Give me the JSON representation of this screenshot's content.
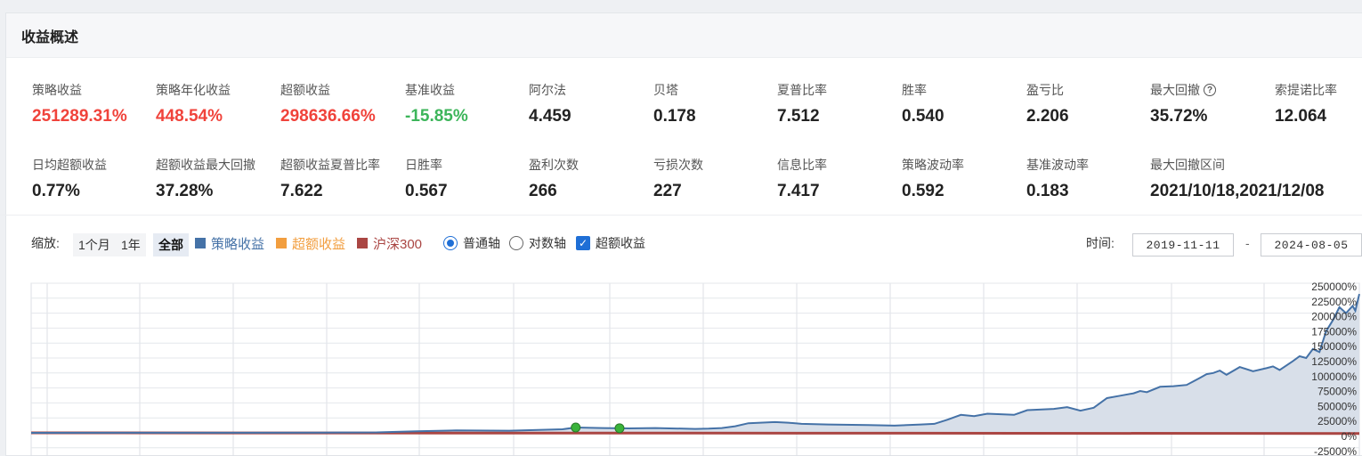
{
  "panel": {
    "title": "收益概述"
  },
  "stats_row1": [
    {
      "label": "策略收益",
      "value": "251289.31%",
      "color": "#f0433b"
    },
    {
      "label": "策略年化收益",
      "value": "448.54%",
      "color": "#f0433b"
    },
    {
      "label": "超额收益",
      "value": "298636.66%",
      "color": "#f0433b"
    },
    {
      "label": "基准收益",
      "value": "-15.85%",
      "color": "#3cb55a"
    },
    {
      "label": "阿尔法",
      "value": "4.459"
    },
    {
      "label": "贝塔",
      "value": "0.178"
    },
    {
      "label": "夏普比率",
      "value": "7.512"
    },
    {
      "label": "胜率",
      "value": "0.540"
    },
    {
      "label": "盈亏比",
      "value": "2.206"
    },
    {
      "label": "最大回撤",
      "value": "35.72%"
    },
    {
      "label": "索提诺比率",
      "value": "12.064"
    }
  ],
  "stats_row2": [
    {
      "label": "日均超额收益",
      "value": "0.77%"
    },
    {
      "label": "超额收益最大回撤",
      "value": "37.28%"
    },
    {
      "label": "超额收益夏普比率",
      "value": "7.622"
    },
    {
      "label": "日胜率",
      "value": "0.567"
    },
    {
      "label": "盈利次数",
      "value": "266"
    },
    {
      "label": "亏损次数",
      "value": "227"
    },
    {
      "label": "信息比率",
      "value": "7.417"
    },
    {
      "label": "策略波动率",
      "value": "0.592"
    },
    {
      "label": "基准波动率",
      "value": "0.183"
    },
    {
      "label": "最大回撤区间",
      "value": "2021/10/18,2021/12/08"
    }
  ],
  "help_icon": "?",
  "toolbar": {
    "zoom_label": "缩放:",
    "zoom_options": [
      "1个月",
      "1年",
      "全部"
    ],
    "zoom_selected": "全部",
    "legend": [
      {
        "label": "策略收益",
        "color": "#4572a7"
      },
      {
        "label": "超额收益",
        "color": "#f29e3f"
      },
      {
        "label": "沪深300",
        "color": "#aa4643"
      }
    ],
    "axis_options": [
      "普通轴",
      "对数轴"
    ],
    "axis_selected": "普通轴",
    "excess_checkbox_label": "超额收益",
    "excess_checked": true,
    "time_label": "时间:",
    "date_from": "2019-11-11",
    "date_sep": "-",
    "date_to": "2024-08-05"
  },
  "chart_data": {
    "type": "area",
    "y_tick_labels": [
      "250000%",
      "225000%",
      "200000%",
      "175000%",
      "150000%",
      "125000%",
      "100000%",
      "75000%",
      "50000%",
      "25000%",
      "0%",
      "-25000%"
    ],
    "ylim": [
      -25000,
      250000
    ],
    "grid": true,
    "series": [
      {
        "name": "策略收益",
        "color": "#4572a7",
        "fill": "#d8dfe9",
        "points": [
          [
            0,
            0
          ],
          [
            0.08,
            100
          ],
          [
            0.16,
            200
          ],
          [
            0.22,
            400
          ],
          [
            0.26,
            800
          ],
          [
            0.29,
            2500
          ],
          [
            0.32,
            4000
          ],
          [
            0.36,
            3500
          ],
          [
            0.4,
            6000
          ],
          [
            0.41,
            9000
          ],
          [
            0.43,
            8000
          ],
          [
            0.45,
            7500
          ],
          [
            0.47,
            8000
          ],
          [
            0.5,
            6500
          ],
          [
            0.51,
            7000
          ],
          [
            0.52,
            8000
          ],
          [
            0.53,
            11000
          ],
          [
            0.54,
            16000
          ],
          [
            0.56,
            18000
          ],
          [
            0.57,
            17000
          ],
          [
            0.58,
            15000
          ],
          [
            0.6,
            14000
          ],
          [
            0.63,
            13000
          ],
          [
            0.65,
            12000
          ],
          [
            0.67,
            14000
          ],
          [
            0.68,
            15000
          ],
          [
            0.69,
            22000
          ],
          [
            0.7,
            30000
          ],
          [
            0.71,
            28000
          ],
          [
            0.72,
            32000
          ],
          [
            0.74,
            30000
          ],
          [
            0.75,
            38000
          ],
          [
            0.77,
            40000
          ],
          [
            0.78,
            43000
          ],
          [
            0.79,
            37000
          ],
          [
            0.8,
            42000
          ],
          [
            0.81,
            58000
          ],
          [
            0.82,
            62000
          ],
          [
            0.83,
            66000
          ],
          [
            0.835,
            70000
          ],
          [
            0.84,
            68000
          ],
          [
            0.85,
            77000
          ],
          [
            0.86,
            78000
          ],
          [
            0.87,
            80000
          ],
          [
            0.875,
            86000
          ],
          [
            0.88,
            92000
          ],
          [
            0.885,
            98000
          ],
          [
            0.89,
            100000
          ],
          [
            0.895,
            104000
          ],
          [
            0.9,
            97000
          ],
          [
            0.91,
            110000
          ],
          [
            0.92,
            103000
          ],
          [
            0.93,
            108000
          ],
          [
            0.935,
            111000
          ],
          [
            0.94,
            105000
          ],
          [
            0.95,
            120000
          ],
          [
            0.955,
            128000
          ],
          [
            0.96,
            125000
          ],
          [
            0.965,
            140000
          ],
          [
            0.97,
            135000
          ],
          [
            0.975,
            170000
          ],
          [
            0.98,
            188000
          ],
          [
            0.985,
            210000
          ],
          [
            0.99,
            200000
          ],
          [
            0.995,
            212000
          ],
          [
            0.997,
            204000
          ],
          [
            1.0,
            232000
          ]
        ]
      },
      {
        "name": "沪深300",
        "color": "#aa4643",
        "points": [
          [
            0,
            0
          ],
          [
            0.5,
            -500
          ],
          [
            1.0,
            -1000
          ]
        ]
      }
    ]
  }
}
